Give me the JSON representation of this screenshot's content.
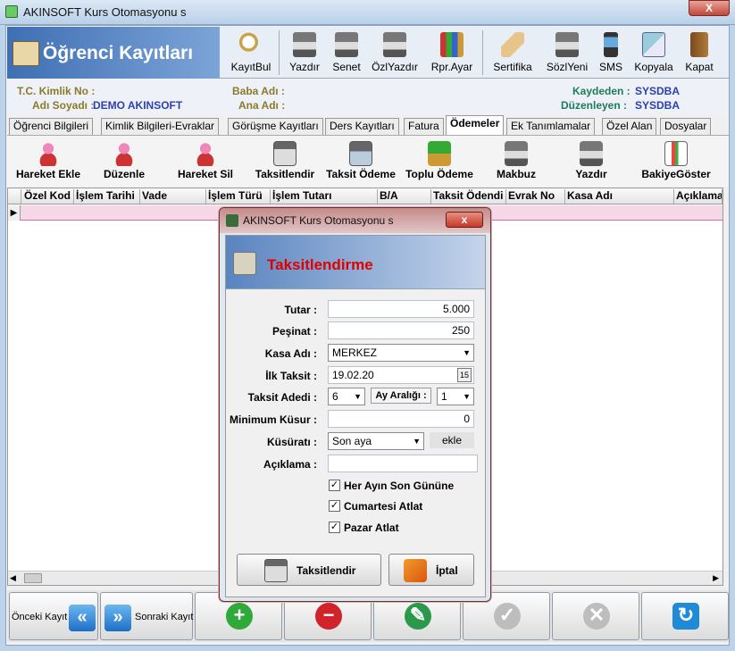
{
  "window": {
    "title": "AKINSOFT Kurs Otomasyonu s",
    "close": "X"
  },
  "header": {
    "title": "Öğrenci Kayıtları"
  },
  "toolbar": [
    {
      "label": "KayıtBul",
      "icon": "magnifier-icon"
    },
    {
      "label": "Yazdır",
      "icon": "printer-icon"
    },
    {
      "label": "Senet",
      "icon": "printer-icon"
    },
    {
      "label": "ÖzlYazdır",
      "icon": "printer-icon"
    },
    {
      "label": "Rpr.Ayar",
      "icon": "books-icon"
    },
    {
      "label": "Sertifika",
      "icon": "certificate-icon"
    },
    {
      "label": "SözlYeni",
      "icon": "printer-icon"
    },
    {
      "label": "SMS",
      "icon": "phone-icon"
    },
    {
      "label": "Kopyala",
      "icon": "copy-icon"
    },
    {
      "label": "Kapat",
      "icon": "door-icon"
    }
  ],
  "info": {
    "tc_label": "T.C. Kimlik No :",
    "tc_value": "",
    "name_label": "Adı Soyadı :",
    "name_value": "DEMO AKINSOFT",
    "father_label": "Baba Adı :",
    "mother_label": "Ana Adı :",
    "created_label": "Kaydeden :",
    "created_value": "SYSDBA",
    "edited_label": "Düzenleyen :",
    "edited_value": "SYSDBA"
  },
  "tabs": [
    "Öğrenci Bilgileri",
    "Kimlik Bilgileri-Evraklar",
    "Görüşme Kayıtları",
    "Ders Kayıtları",
    "Fatura",
    "Ödemeler",
    "Ek Tanımlamalar",
    "Özel Alan",
    "Dosyalar"
  ],
  "selected_tab": "Ödemeler",
  "subtoolbar": [
    {
      "label": "Hareket Ekle",
      "icon": "person-add-icon"
    },
    {
      "label": "Düzenle",
      "icon": "person-edit-icon"
    },
    {
      "label": "Hareket Sil",
      "icon": "person-remove-icon"
    },
    {
      "label": "Taksitlendir",
      "icon": "calculator-icon"
    },
    {
      "label": "Taksit Ödeme",
      "icon": "cash-register-icon"
    },
    {
      "label": "Toplu Ödeme",
      "icon": "money-stack-icon"
    },
    {
      "label": "Makbuz",
      "icon": "printer-icon"
    },
    {
      "label": "Yazdır",
      "icon": "printer-icon"
    },
    {
      "label": "BakiyeGöster",
      "icon": "report-icon"
    }
  ],
  "grid": {
    "columns": [
      "Özel Kod",
      "İşlem Tarihi",
      "Vade",
      "İşlem Türü",
      "İşlem Tutarı",
      "B/A",
      "Taksit Ödendi",
      "Evrak No",
      "Kasa Adı",
      "Açıklama"
    ]
  },
  "bottom": {
    "prev": "Önceki Kayıt",
    "next": "Sonraki Kayıt"
  },
  "dialog": {
    "title": "AKINSOFT Kurs Otomasyonu s",
    "close": "x",
    "heading": "Taksitlendirme",
    "fields": {
      "tutar_label": "Tutar :",
      "tutar": "5.000",
      "pesinat_label": "Peşinat :",
      "pesinat": "250",
      "kasa_label": "Kasa Adı :",
      "kasa": "MERKEZ",
      "ilk_label": "İlk Taksit :",
      "ilk": "19.02.20",
      "cal": "15",
      "adet_label": "Taksit Adedi :",
      "adet": "6",
      "aralik_label": "Ay Aralığı :",
      "aralik": "1",
      "kusur_label": "Minimum Küsur :",
      "kusur": "0",
      "kusurati_label": "Küsüratı :",
      "kusurati": "Son aya",
      "ekle": "ekle",
      "aciklama_label": "Açıklama :",
      "aciklama": ""
    },
    "checks": [
      {
        "label": "Her Ayın Son Gününe",
        "checked": true
      },
      {
        "label": "Cumartesi Atlat",
        "checked": true
      },
      {
        "label": "Pazar Atlat",
        "checked": true
      }
    ],
    "buttons": {
      "ok": "Taksitlendir",
      "cancel": "İptal"
    }
  }
}
